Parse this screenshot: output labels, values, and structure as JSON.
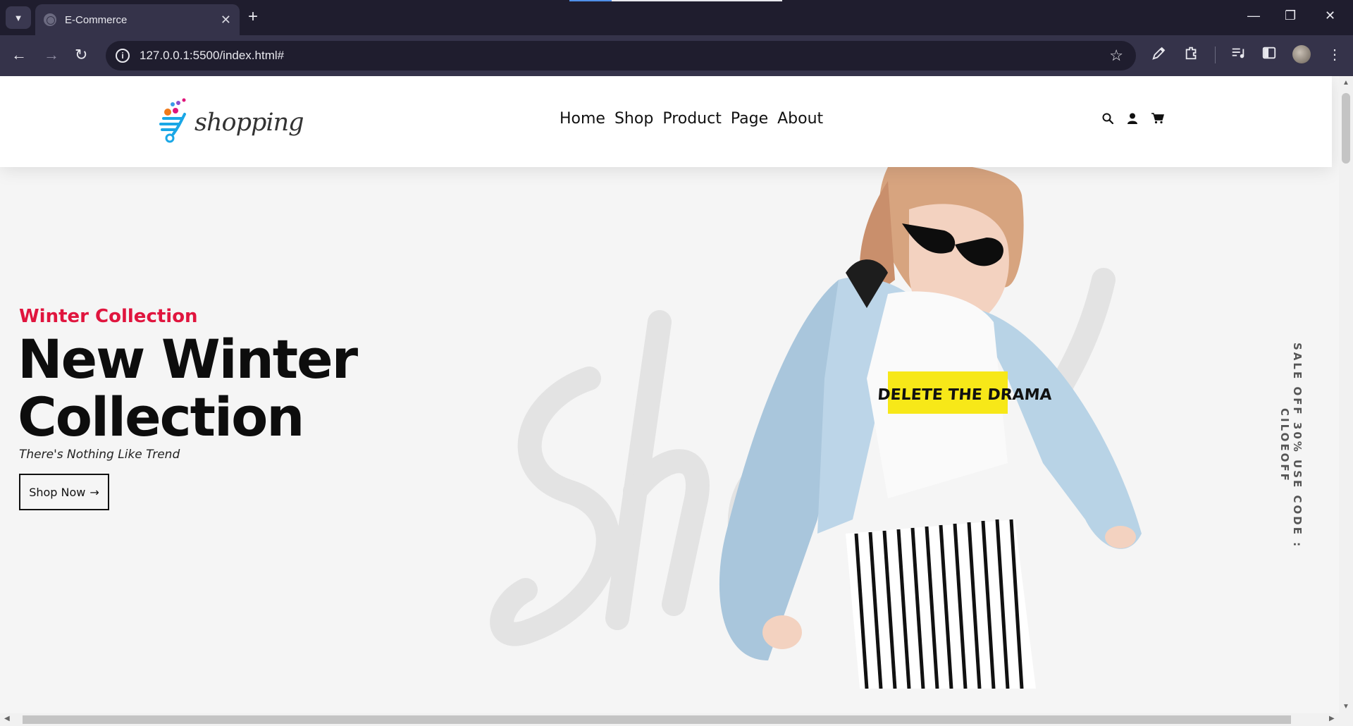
{
  "browser": {
    "tab_title": "E-Commerce",
    "tab_close": "✕",
    "new_tab": "+",
    "url": "127.0.0.1:5500/index.html#",
    "icons": [
      "tab-search-icon",
      "favicon-globe-icon",
      "back-icon",
      "forward-icon",
      "reload-icon",
      "site-info-icon",
      "star-icon",
      "eyedropper-icon",
      "extensions-icon",
      "media-icon",
      "sidebar-icon",
      "profile-avatar",
      "more-menu-icon",
      "minimize-icon",
      "restore-icon",
      "close-window-icon"
    ]
  },
  "site": {
    "logo_text": "shopping",
    "nav": [
      "Home",
      "Shop",
      "Product",
      "Page",
      "About"
    ],
    "header_icons": [
      "search-icon",
      "user-icon",
      "cart-icon"
    ],
    "accent_color": "#e0153e"
  },
  "hero": {
    "subtitle": "Winter Collection",
    "title": "New Winter Collection",
    "tagline": "There's Nothing Like Trend",
    "button_label": "Shop Now",
    "side_promo": "SALE OFF 30% USE CODE : CILOEOFF",
    "model_shirt_text": "DELETE THE DRAMA",
    "background_script": "Shopaholic"
  }
}
